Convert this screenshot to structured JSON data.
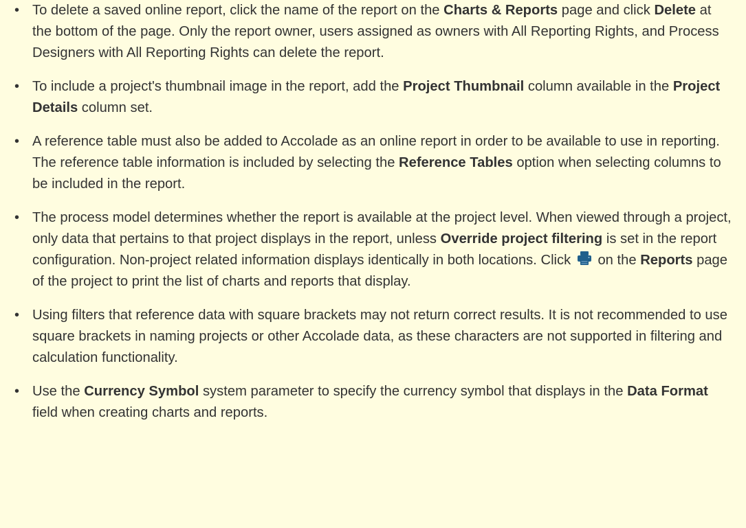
{
  "bullets": {
    "delete": {
      "t1": "To delete a saved online report, click the name of the report on the ",
      "b1": "Charts & Reports",
      "t2": " page and click ",
      "b2": "Delete",
      "t3": " at the bottom of the page. Only the report owner, users assigned as owners with All Reporting Rights, and Process Designers with All Reporting Rights can delete the report."
    },
    "thumbnail": {
      "t1": "To include a project's thumbnail image in the report, add the ",
      "b1": "Project Thumbnail",
      "t2": " column available in the ",
      "b2": "Project Details",
      "t3": " column set."
    },
    "reference": {
      "t1": "A reference table must also be added to Accolade as an online report in order to be available to use in reporting. The reference table information is included by selecting the ",
      "b1": "Reference Tables",
      "t2": " option when selecting columns to be included in the report."
    },
    "process": {
      "t1": "The process model determines whether the report is available at the project level. When viewed through a project, only data that pertains to that project displays in the report, unless ",
      "b1": "Override project filtering",
      "t2": " is set in the report configuration. Non-project related information displays identically in both locations. Click ",
      "icon": "printer-icon",
      "t3": " on the ",
      "b2": "Reports",
      "t4": " page of the project to print the list of charts and reports that display."
    },
    "filters": {
      "t1": "Using filters that reference data with square brackets may not return correct results. It is not recommended to use square brackets in naming projects or other Accolade data, as these characters are not supported in filtering and calculation functionality."
    },
    "currency": {
      "t1": "Use the ",
      "b1": "Currency Symbol",
      "t2": " system parameter to specify the currency symbol that displays in the ",
      "b2": "Data Format",
      "t3": " field when creating charts and reports."
    }
  },
  "colors": {
    "background": "#fffde0",
    "text": "#333333",
    "icon": "#1f5f8b"
  }
}
